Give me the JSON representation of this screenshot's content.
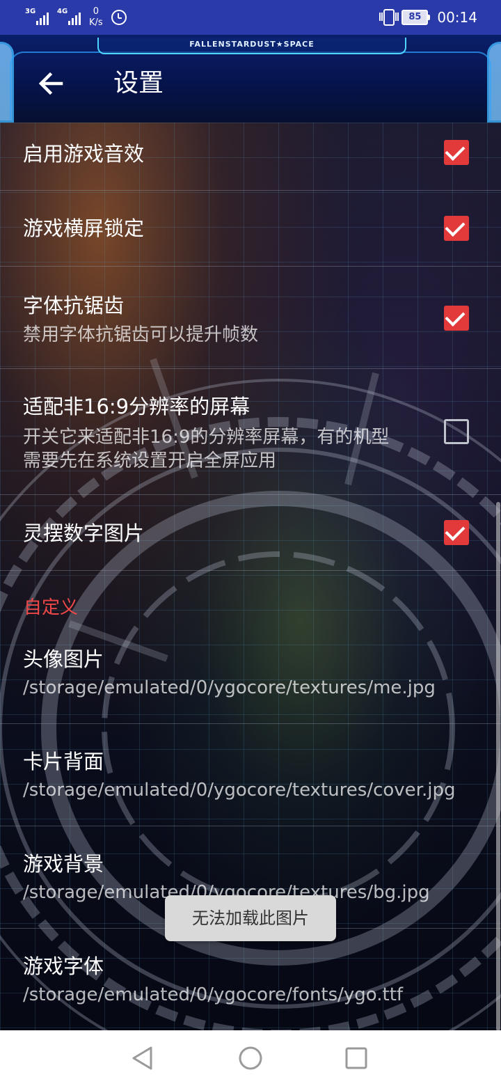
{
  "status_bar": {
    "net1": "3G",
    "net2": "4G",
    "speed_value": "0",
    "speed_unit": "K/s",
    "battery": "85",
    "time": "00:14",
    "icons": [
      "signal-icon",
      "alarm-icon",
      "vibrate-icon",
      "battery-icon"
    ]
  },
  "header": {
    "brand": "FALLENSTARDUST★SPACE",
    "title": "设置",
    "back_icon": "back-arrow-icon"
  },
  "settings": [
    {
      "title": "启用游戏音效",
      "summary": "",
      "checked": true
    },
    {
      "title": "游戏横屏锁定",
      "summary": "",
      "checked": true
    },
    {
      "title": "字体抗锯齿",
      "summary": "禁用字体抗锯齿可以提升帧数",
      "checked": true
    },
    {
      "title": "适配非16:9分辨率的屏幕",
      "summary_line1": "开关它来适配非16:9的分辨率屏幕，有的机型",
      "summary_line2": "需要先在系统设置开启全屏应用",
      "checked": false
    },
    {
      "title": "灵摆数字图片",
      "summary": "",
      "checked": true
    }
  ],
  "custom_section": {
    "label": "自定义",
    "items": [
      {
        "title": "头像图片",
        "path": "/storage/emulated/0/ygocore/textures/me.jpg"
      },
      {
        "title": "卡片背面",
        "path": "/storage/emulated/0/ygocore/textures/cover.jpg"
      },
      {
        "title": "游戏背景",
        "path": "/storage/emulated/0/ygocore/textures/bg.jpg"
      },
      {
        "title": "游戏字体",
        "path": "/storage/emulated/0/ygocore/fonts/ygo.ttf"
      }
    ]
  },
  "toast": "无法加载此图片",
  "colors": {
    "status_bar": "#2a3aa8",
    "accent": "#e23a3a",
    "section_label": "#f04848"
  },
  "nav_bar": {
    "icons": [
      "nav-back-icon",
      "nav-home-icon",
      "nav-recent-icon"
    ]
  }
}
